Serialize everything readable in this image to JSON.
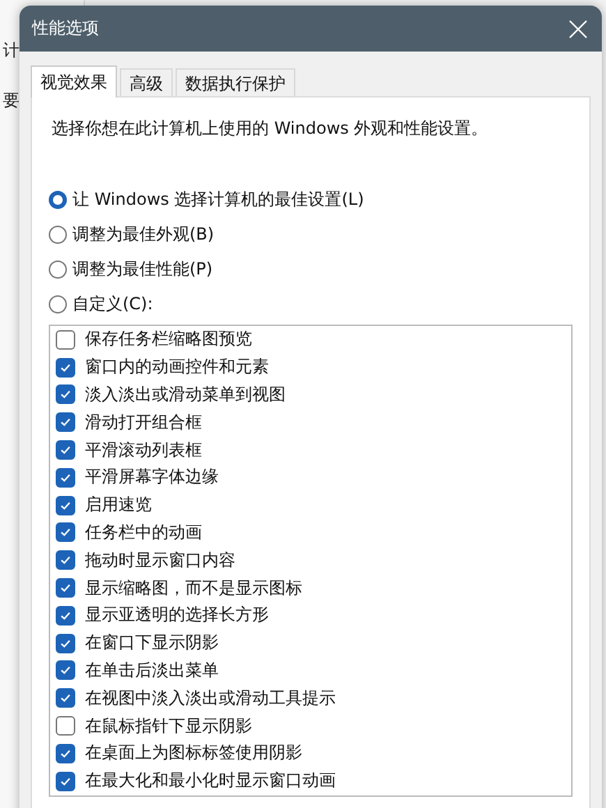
{
  "background_window": {
    "texts": [
      "计",
      "要"
    ]
  },
  "window": {
    "title": "性能选项"
  },
  "tabs": [
    {
      "label": "视觉效果",
      "selected": true
    },
    {
      "label": "高级",
      "selected": false
    },
    {
      "label": "数据执行保护",
      "selected": false
    }
  ],
  "description": "选择你想在此计算机上使用的 Windows 外观和性能设置。",
  "options": [
    {
      "label": "让 Windows 选择计算机的最佳设置(L)",
      "selected": true
    },
    {
      "label": "调整为最佳外观(B)",
      "selected": false
    },
    {
      "label": "调整为最佳性能(P)",
      "selected": false
    },
    {
      "label": "自定义(C):",
      "selected": false
    }
  ],
  "effects": [
    {
      "label": "保存任务栏缩略图预览",
      "checked": false
    },
    {
      "label": "窗口内的动画控件和元素",
      "checked": true
    },
    {
      "label": "淡入淡出或滑动菜单到视图",
      "checked": true
    },
    {
      "label": "滑动打开组合框",
      "checked": true
    },
    {
      "label": "平滑滚动列表框",
      "checked": true
    },
    {
      "label": "平滑屏幕字体边缘",
      "checked": true
    },
    {
      "label": "启用速览",
      "checked": true
    },
    {
      "label": "任务栏中的动画",
      "checked": true
    },
    {
      "label": "拖动时显示窗口内容",
      "checked": true
    },
    {
      "label": "显示缩略图，而不是显示图标",
      "checked": true
    },
    {
      "label": "显示亚透明的选择长方形",
      "checked": true
    },
    {
      "label": "在窗口下显示阴影",
      "checked": true
    },
    {
      "label": "在单击后淡出菜单",
      "checked": true
    },
    {
      "label": "在视图中淡入淡出或滑动工具提示",
      "checked": true
    },
    {
      "label": "在鼠标指针下显示阴影",
      "checked": false
    },
    {
      "label": "在桌面上为图标标签使用阴影",
      "checked": true
    },
    {
      "label": "在最大化和最小化时显示窗口动画",
      "checked": true
    }
  ]
}
